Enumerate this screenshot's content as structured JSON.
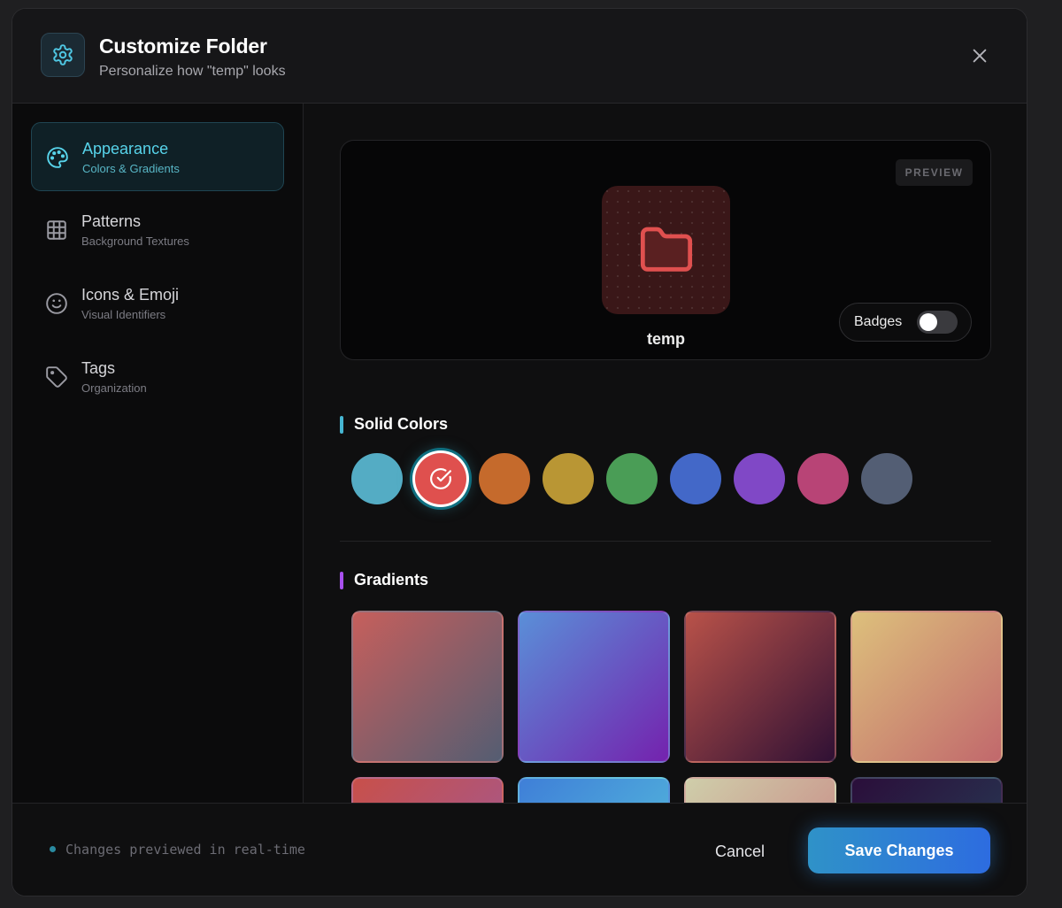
{
  "header": {
    "icon": "gear-icon",
    "title": "Customize Folder",
    "subtitle": "Personalize how \"temp\" looks",
    "close_icon": "close-icon"
  },
  "sidebar": {
    "items": [
      {
        "label": "Appearance",
        "sublabel": "Colors & Gradients",
        "icon": "palette-icon",
        "active": true
      },
      {
        "label": "Patterns",
        "sublabel": "Background Textures",
        "icon": "grid-icon",
        "active": false
      },
      {
        "label": "Icons & Emoji",
        "sublabel": "Visual Identifiers",
        "icon": "smiley-icon",
        "active": false
      },
      {
        "label": "Tags",
        "sublabel": "Organization",
        "icon": "tag-icon",
        "active": false
      }
    ]
  },
  "preview": {
    "badge": "PREVIEW",
    "folder_name": "temp",
    "folder_icon": "folder-icon",
    "folder_color": "#e0504f",
    "badges_label": "Badges",
    "badges_on": false
  },
  "solid_colors": {
    "title": "Solid Colors",
    "accent": "#46b6d2",
    "swatches": [
      "#54acc4",
      "#df504e",
      "#c56a2c",
      "#b99634",
      "#4a9d56",
      "#4368c8",
      "#8048c6",
      "#b84476",
      "#535e74"
    ],
    "selected_index": 1
  },
  "gradients": {
    "title": "Gradients",
    "accent": "#a850ee",
    "items": [
      [
        "#c65f5c",
        "#545d72"
      ],
      [
        "#5a8fd8",
        "#7422ae"
      ],
      [
        "#b95249",
        "#2f1034"
      ],
      [
        "#ddc07c",
        "#c1686c"
      ],
      [
        "#c8504a",
        "#9a5aa0"
      ],
      [
        "#3f7fd8",
        "#58c6dc"
      ],
      [
        "#cfceaa",
        "#c77a7e"
      ],
      [
        "#2a0e3a",
        "#27445a"
      ]
    ]
  },
  "footer": {
    "note": "Changes previewed in real-time",
    "cancel_label": "Cancel",
    "save_label": "Save Changes"
  }
}
